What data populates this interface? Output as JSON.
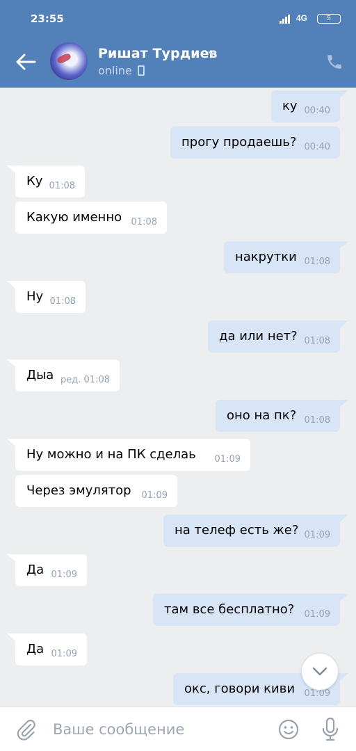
{
  "status_bar": {
    "time": "23:55",
    "network": "4G",
    "battery": "5"
  },
  "header": {
    "contact_name": "Ришат Турдиев",
    "status": "online"
  },
  "messages": [
    {
      "dir": "out",
      "text": "ку",
      "time": "00:40"
    },
    {
      "dir": "out",
      "text": "прогу продаешь?",
      "time": "00:40"
    },
    {
      "dir": "in",
      "text": "Ку",
      "time": "01:08"
    },
    {
      "dir": "in",
      "text": "Какую именно",
      "time": "01:08"
    },
    {
      "dir": "out",
      "text": "накрутки",
      "time": "01:08"
    },
    {
      "dir": "in",
      "text": "Ну",
      "time": "01:08"
    },
    {
      "dir": "out",
      "text": "да или нет?",
      "time": "01:08"
    },
    {
      "dir": "in",
      "text": "Дыа",
      "time": "ред. 01:08"
    },
    {
      "dir": "out",
      "text": "оно на пк?",
      "time": "01:08"
    },
    {
      "dir": "in",
      "text": "Ну можно и на ПК сделаь",
      "time": "01:09"
    },
    {
      "dir": "in",
      "text": "Через эмулятор",
      "time": "01:09"
    },
    {
      "dir": "out",
      "text": "на телеф есть же?",
      "time": "01:09"
    },
    {
      "dir": "in",
      "text": "Да",
      "time": "01:09"
    },
    {
      "dir": "out",
      "text": "там все бесплатно?",
      "time": "01:09"
    },
    {
      "dir": "in",
      "text": "Да",
      "time": "01:09"
    },
    {
      "dir": "out",
      "text": "окс, говори киви",
      "time": "01:09"
    }
  ],
  "composer": {
    "placeholder": "Ваше сообщение"
  },
  "icons": {
    "back": "arrow-left-icon",
    "call": "phone-icon",
    "attach": "paperclip-icon",
    "emoji": "smile-icon",
    "mic": "microphone-icon",
    "scroll": "chevron-down-icon",
    "device": "mobile-device-icon",
    "signal": "signal-icon"
  },
  "colors": {
    "header": "#5181b8",
    "background": "#edeef0",
    "outgoing": "#d8e5f6",
    "incoming": "#ffffff"
  }
}
